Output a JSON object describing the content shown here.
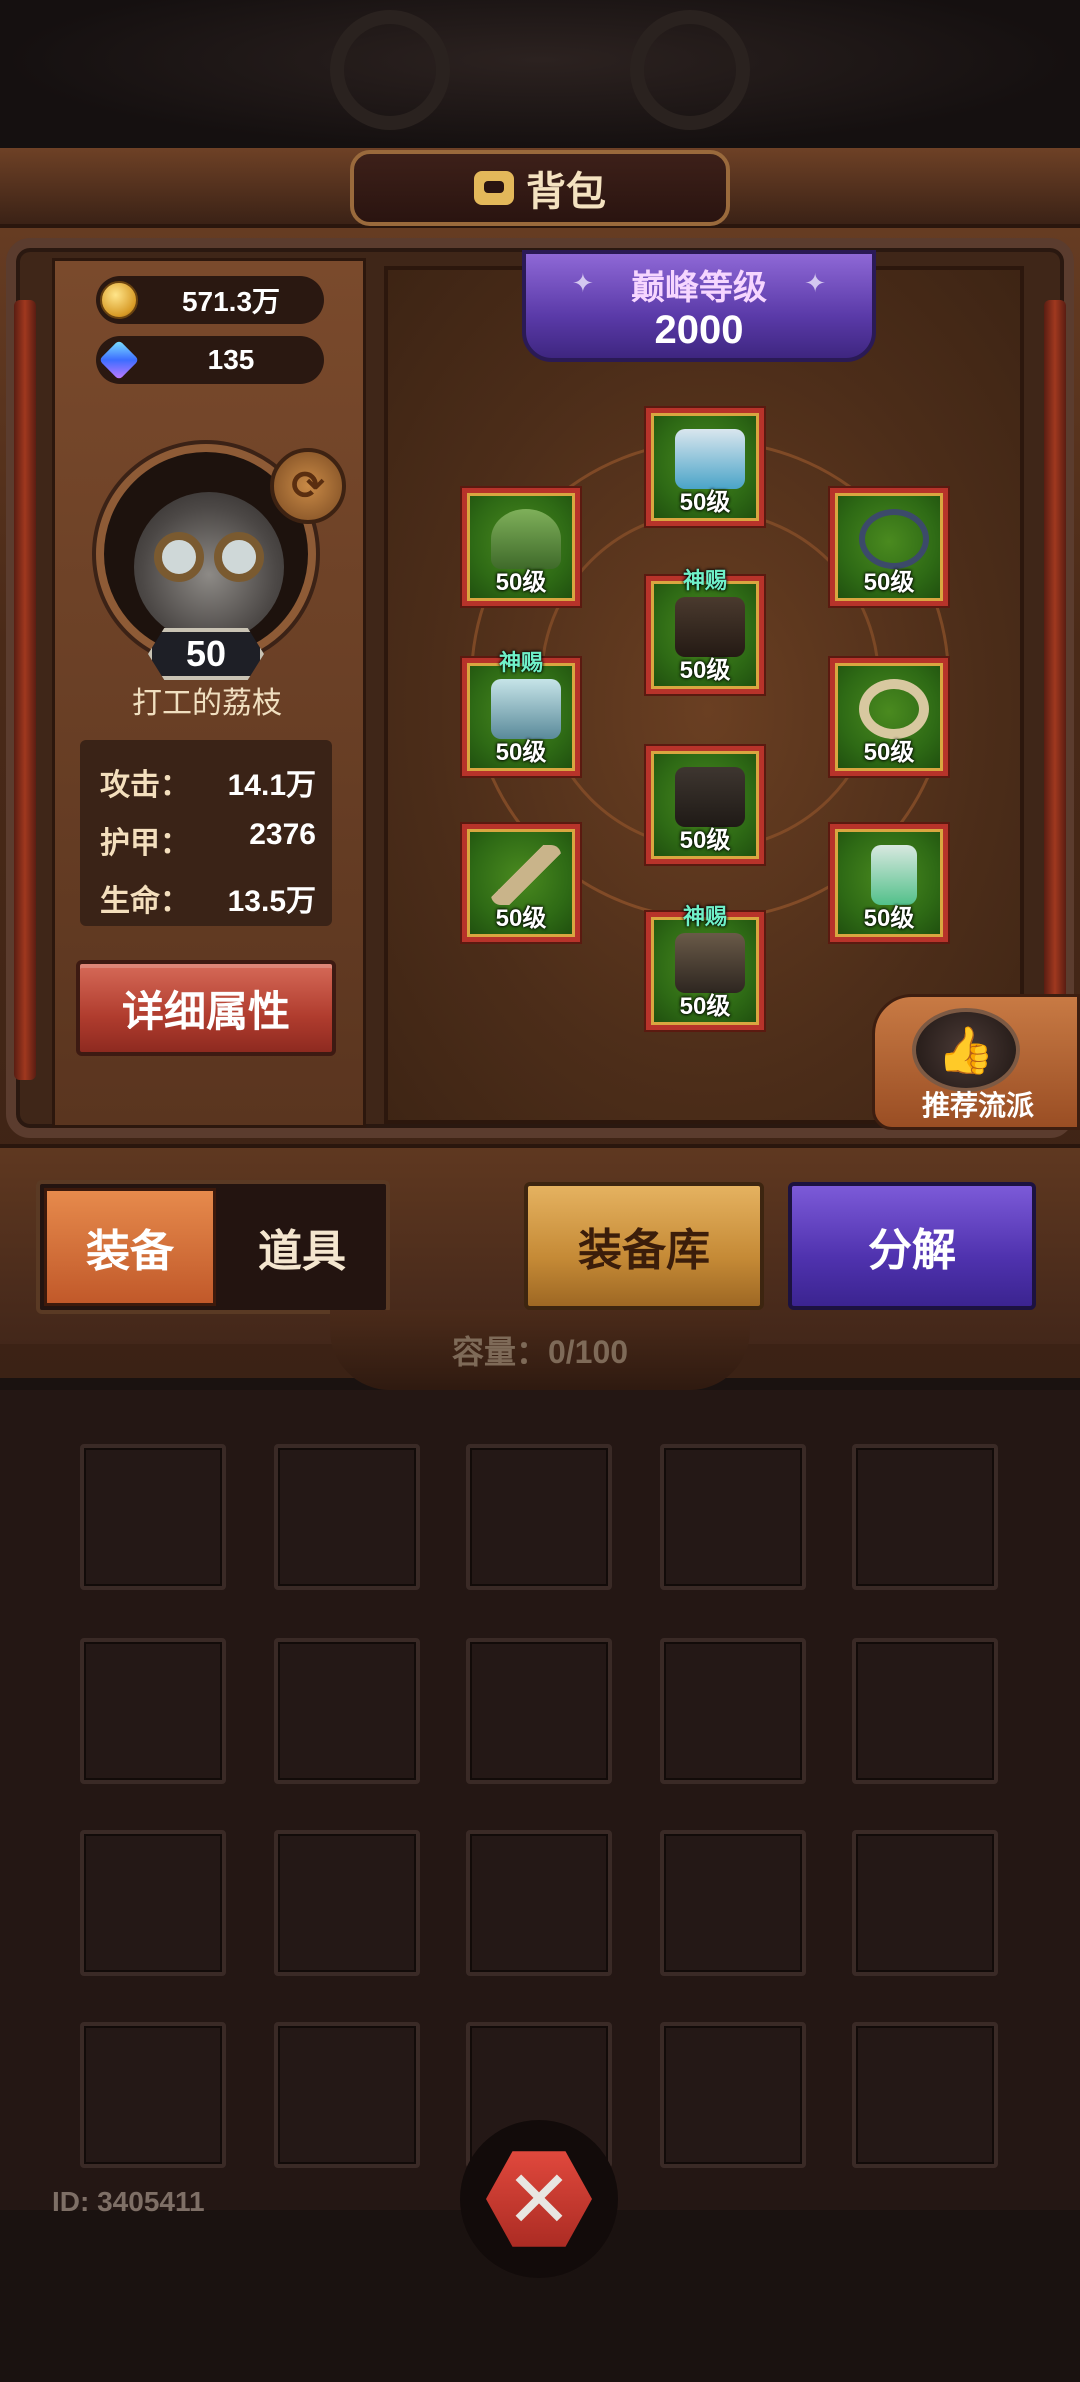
{
  "header": {
    "title": "背包"
  },
  "currency": {
    "gold": "571.3万",
    "gems": "135"
  },
  "player": {
    "level": "50",
    "name": "打工的荔枝",
    "stats": [
      {
        "label": "攻击：",
        "value": "14.1万"
      },
      {
        "label": "护甲：",
        "value": "2376"
      },
      {
        "label": "生命：",
        "value": "13.5万"
      }
    ],
    "detail_button": "详细属性"
  },
  "peak": {
    "title": "巅峰等级",
    "value": "2000"
  },
  "equipment": {
    "slots": [
      {
        "name": "helmet",
        "level": "50级",
        "gift": ""
      },
      {
        "name": "mask",
        "level": "50级",
        "gift": ""
      },
      {
        "name": "amulet",
        "level": "50级",
        "gift": ""
      },
      {
        "name": "gloves",
        "level": "50级",
        "gift": "神赐"
      },
      {
        "name": "armor",
        "level": "50级",
        "gift": "神赐"
      },
      {
        "name": "ring",
        "level": "50级",
        "gift": ""
      },
      {
        "name": "syringe",
        "level": "50级",
        "gift": ""
      },
      {
        "name": "pants",
        "level": "50级",
        "gift": ""
      },
      {
        "name": "potion",
        "level": "50级",
        "gift": ""
      },
      {
        "name": "boots",
        "level": "50级",
        "gift": "神赐"
      }
    ]
  },
  "recommend": {
    "label": "推荐流派"
  },
  "tabs": {
    "equip": "装备",
    "items": "道具"
  },
  "buttons": {
    "storage": "装备库",
    "decompose": "分解"
  },
  "capacity": "容量：0/100",
  "footer": {
    "id_text": "ID: 3405411"
  }
}
